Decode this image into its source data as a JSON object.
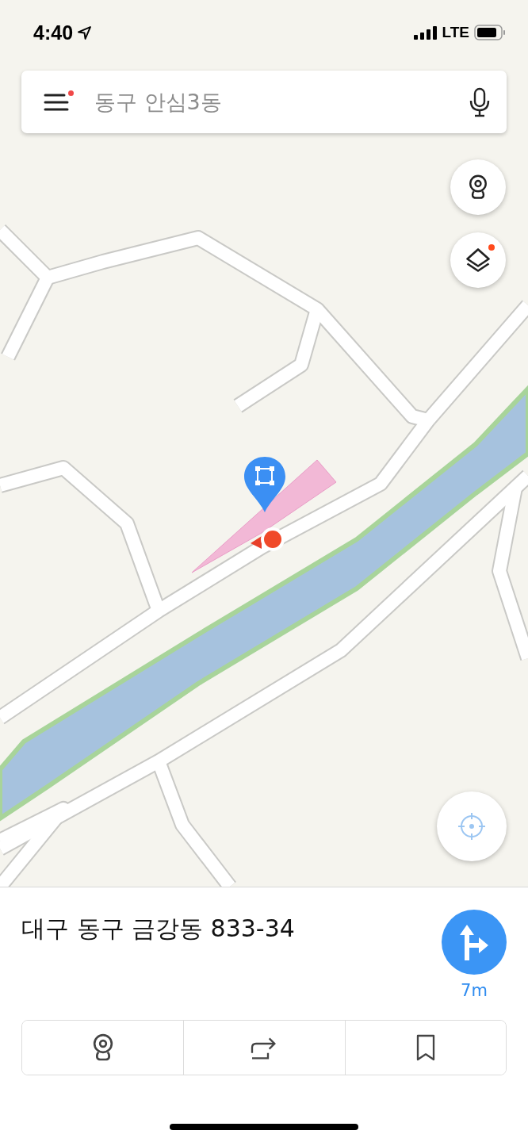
{
  "status_bar": {
    "time": "4:40",
    "network": "LTE"
  },
  "search": {
    "placeholder": "동구 안심3동",
    "menu_badge": true
  },
  "map_buttons": [
    {
      "kind": "cctv",
      "badge": false
    },
    {
      "kind": "layers",
      "badge": true
    }
  ],
  "place": {
    "address": "대구 동구 금강동 833-34",
    "distance": "7m"
  },
  "actions": [
    {
      "kind": "cctv"
    },
    {
      "kind": "share"
    },
    {
      "kind": "bookmark"
    }
  ]
}
